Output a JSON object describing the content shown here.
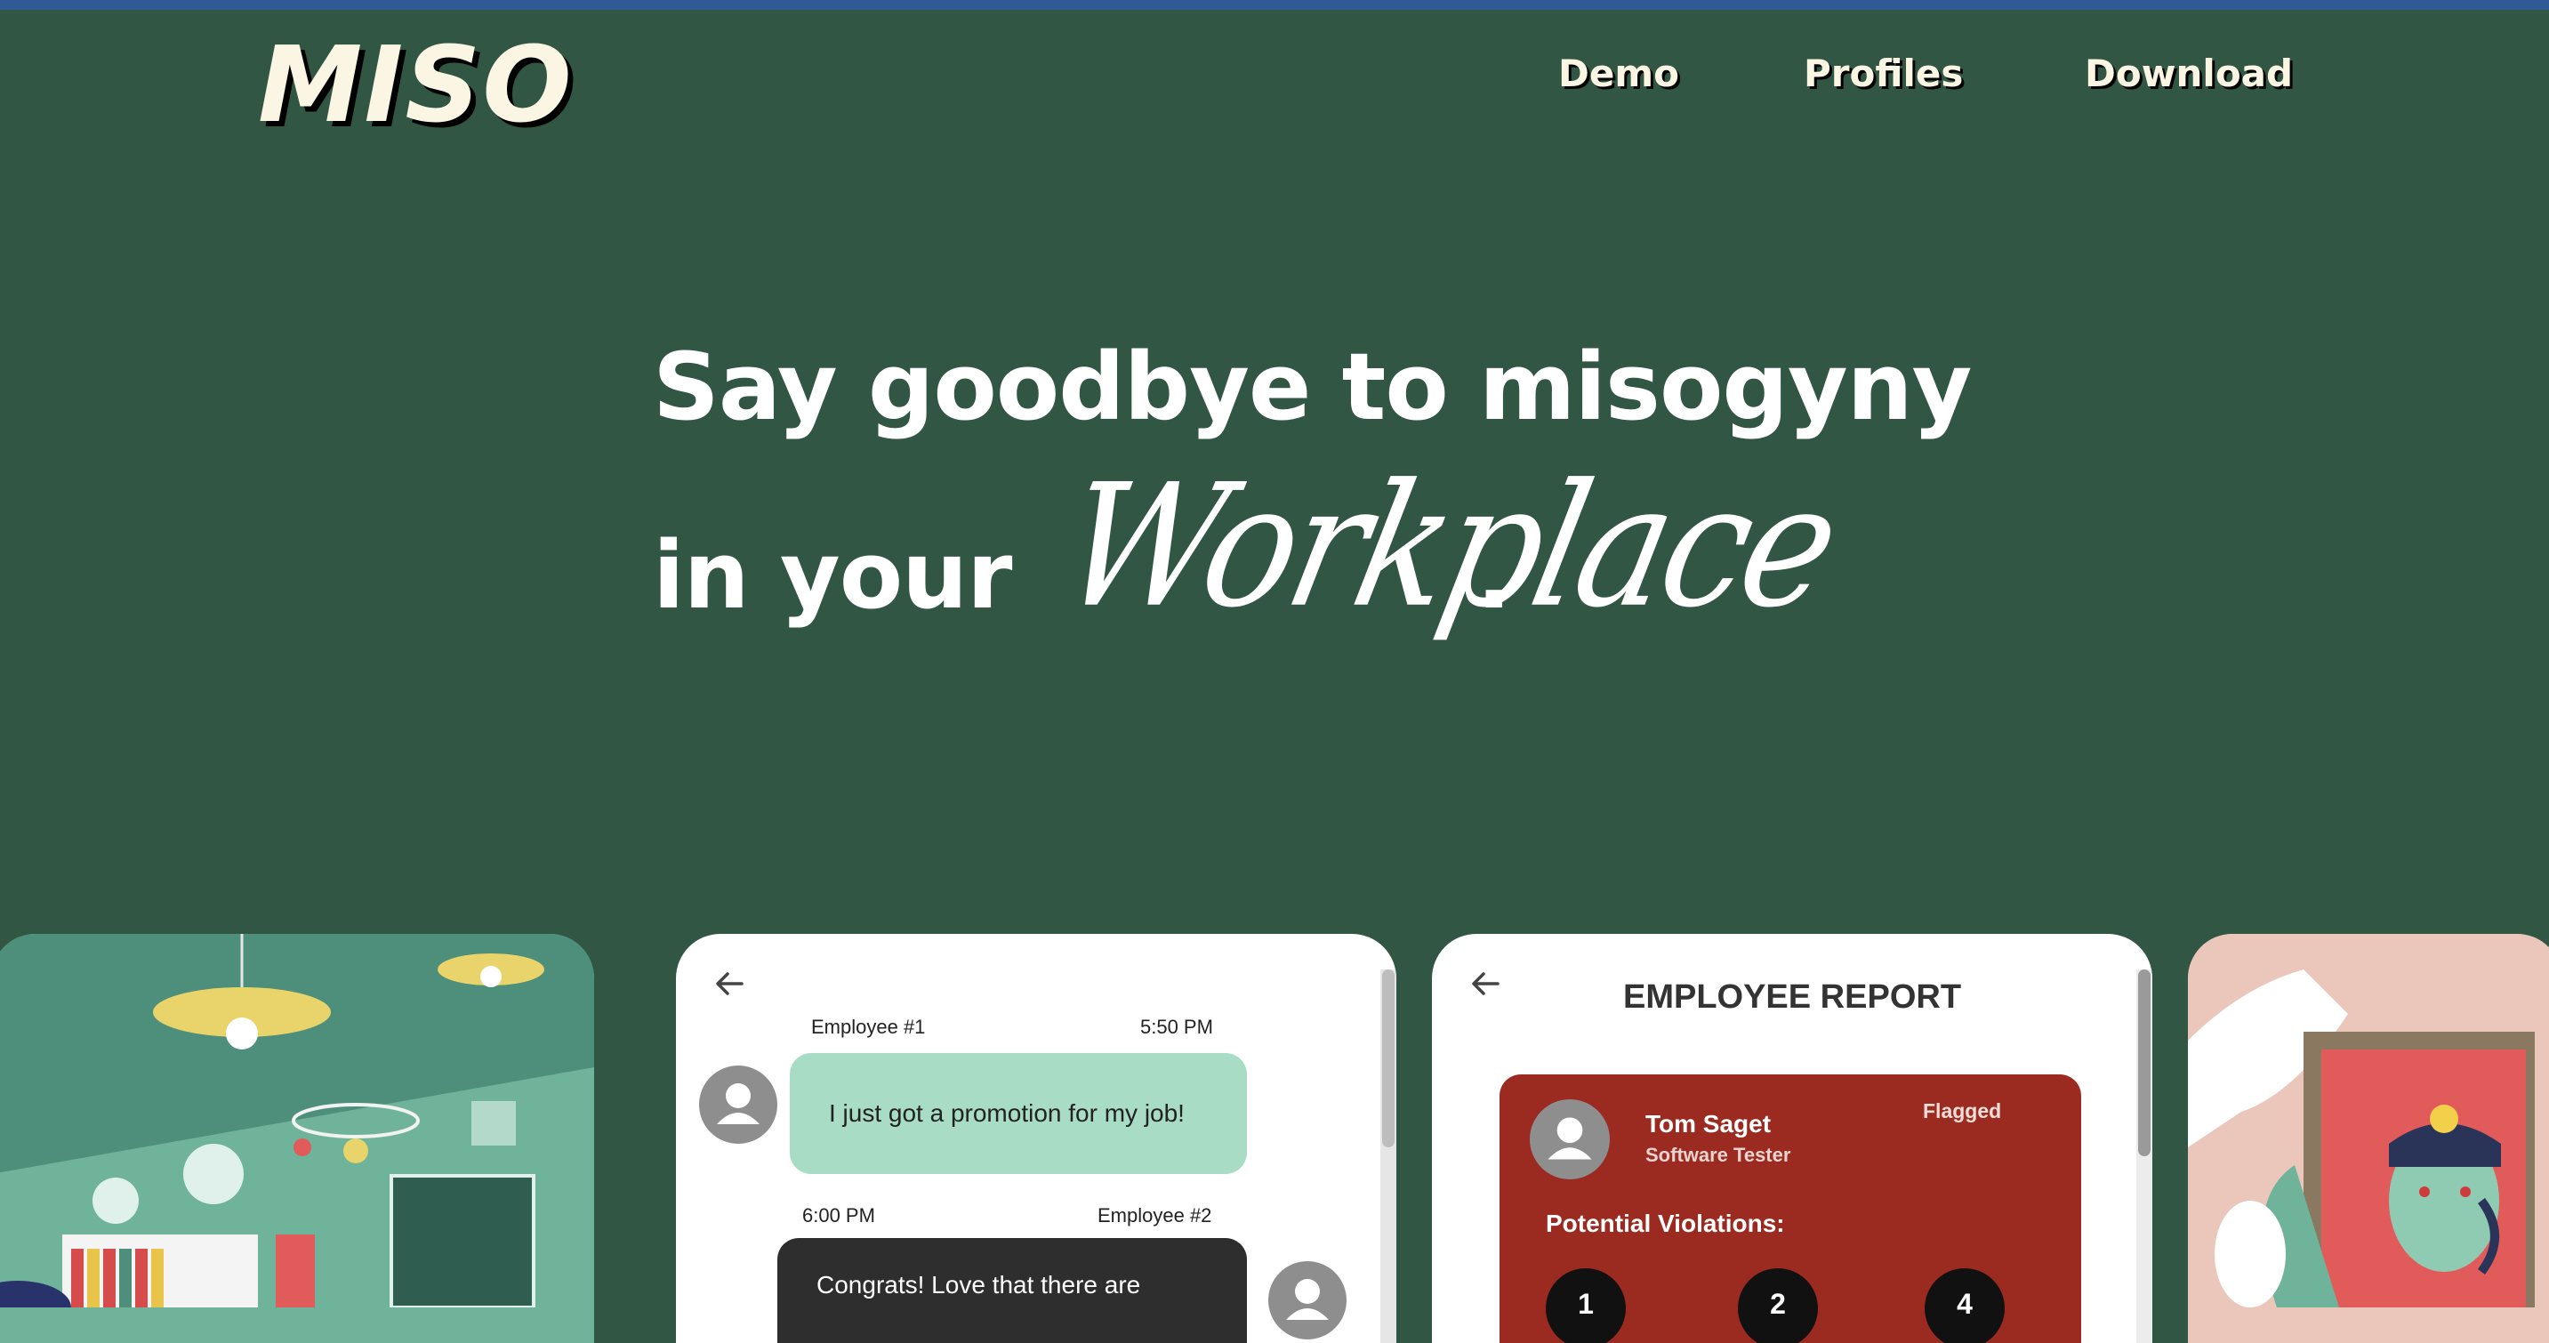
{
  "header": {
    "logo": "MISO",
    "nav": [
      "Demo",
      "Profiles",
      "Download"
    ]
  },
  "hero": {
    "line1": "Say goodbye to misogyny",
    "line2_prefix": "in your",
    "line2_script": "Workplace",
    "line2_suffix": "."
  },
  "chat_card": {
    "msg1": {
      "sender": "Employee #1",
      "time": "5:50 PM",
      "text": "I just got a promotion for my job!"
    },
    "msg2": {
      "sender": "Employee #2",
      "time": "6:00 PM",
      "text": "Congrats! Love that there are"
    }
  },
  "report_card": {
    "title": "EMPLOYEE REPORT",
    "name": "Tom Saget",
    "role": "Software Tester",
    "status": "Flagged",
    "violations_label": "Potential Violations:",
    "violations": [
      "1",
      "2",
      "4"
    ]
  },
  "colors": {
    "background": "#315644",
    "accent_mint": "#a8dcc5",
    "report_red": "#9b2a21",
    "text_cream": "#fbf6e3"
  }
}
